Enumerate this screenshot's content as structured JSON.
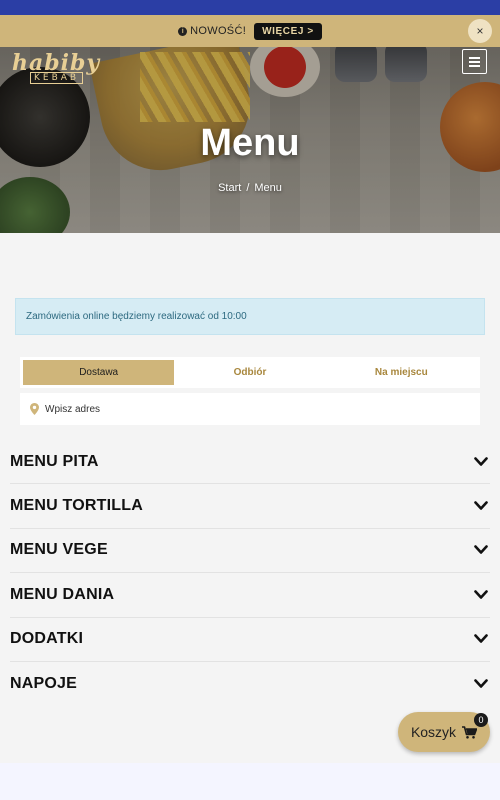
{
  "notice": {
    "text": "NOWOŚĆ!",
    "more_label": "WIĘCEJ >",
    "close_label": "×"
  },
  "logo": {
    "word": "habiby",
    "sub": "KEBAB"
  },
  "hero": {
    "title": "Menu",
    "breadcrumb": [
      "Start",
      "Menu"
    ],
    "breadcrumb_separator": "/"
  },
  "alert": {
    "text": "Zamówienia online będziemy realizować od 10:00"
  },
  "order_tabs": [
    {
      "label": "Dostawa",
      "active": true
    },
    {
      "label": "Odbiór",
      "active": false
    },
    {
      "label": "Na miejscu",
      "active": false
    }
  ],
  "address": {
    "placeholder": "Wpisz adres"
  },
  "categories": [
    {
      "label": "MENU PITA"
    },
    {
      "label": "MENU TORTILLA"
    },
    {
      "label": "MENU VEGE"
    },
    {
      "label": "MENU DANIA"
    },
    {
      "label": "DODATKI"
    },
    {
      "label": "NAPOJE"
    }
  ],
  "cart": {
    "label": "Koszyk",
    "count": "0"
  },
  "colors": {
    "accent": "#cfb57a",
    "top_bar": "#2b3ea5",
    "alert_bg": "#d6ecf4"
  }
}
